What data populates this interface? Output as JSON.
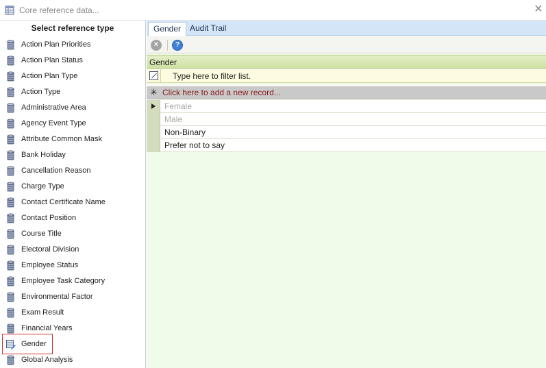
{
  "window": {
    "title": "Core reference data...",
    "close_glyph": "✕"
  },
  "left_panel": {
    "header": "Select reference type",
    "items": [
      {
        "label": "Action Plan Priorities",
        "icon": "database-icon"
      },
      {
        "label": "Action Plan Status",
        "icon": "database-icon"
      },
      {
        "label": "Action Plan Type",
        "icon": "database-icon"
      },
      {
        "label": "Action Type",
        "icon": "database-icon"
      },
      {
        "label": "Administrative Area",
        "icon": "database-icon"
      },
      {
        "label": "Agency Event Type",
        "icon": "database-icon"
      },
      {
        "label": "Attribute Common Mask",
        "icon": "database-icon"
      },
      {
        "label": "Bank Holiday",
        "icon": "database-icon"
      },
      {
        "label": "Cancellation Reason",
        "icon": "database-icon"
      },
      {
        "label": "Charge Type",
        "icon": "database-icon"
      },
      {
        "label": "Contact Certificate Name",
        "icon": "database-icon"
      },
      {
        "label": "Contact Position",
        "icon": "database-icon"
      },
      {
        "label": "Course Title",
        "icon": "database-icon"
      },
      {
        "label": "Electoral Division",
        "icon": "database-icon"
      },
      {
        "label": "Employee Status",
        "icon": "database-icon"
      },
      {
        "label": "Employee Task Category",
        "icon": "database-icon"
      },
      {
        "label": "Environmental Factor",
        "icon": "database-icon"
      },
      {
        "label": "Exam Result",
        "icon": "database-icon"
      },
      {
        "label": "Financial Years",
        "icon": "database-icon"
      },
      {
        "label": "Gender",
        "icon": "database-edit-icon",
        "selected": true
      },
      {
        "label": "Global Analysis",
        "icon": "database-icon"
      }
    ]
  },
  "right_panel": {
    "tabs": [
      {
        "label": "Gender",
        "active": true
      },
      {
        "label": "Audit Trail",
        "active": false
      }
    ],
    "toolbar": {
      "delete_icon": "delete-icon",
      "help_icon": "help-icon"
    },
    "grid": {
      "column_header": "Gender",
      "filter_placeholder": "Type here to filter list.",
      "add_row_text": "Click here to add a new record...",
      "rows": [
        {
          "value": "Female",
          "dimmed": true,
          "current": true
        },
        {
          "value": "Male",
          "dimmed": true,
          "current": false
        },
        {
          "value": "Non-Binary",
          "dimmed": false,
          "current": false
        },
        {
          "value": "Prefer not to say",
          "dimmed": false,
          "current": false
        }
      ]
    }
  },
  "colors": {
    "selection_outline": "#d03030",
    "add_row_text": "#8a1a1a",
    "grid_background": "#f0fbe9"
  }
}
